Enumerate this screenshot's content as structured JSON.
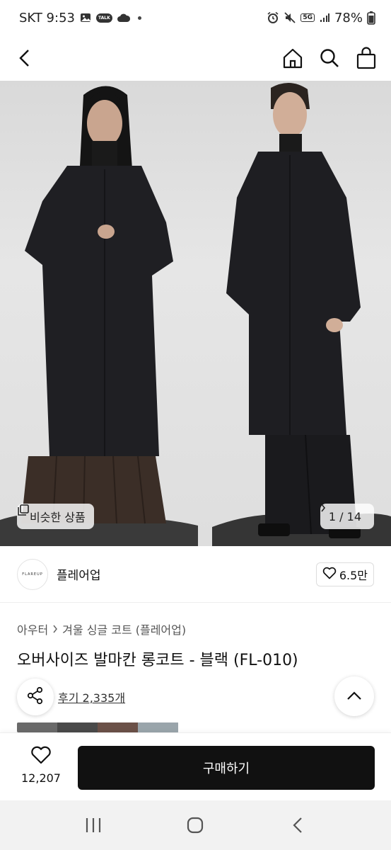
{
  "status_bar": {
    "carrier_time": "SKT 9:53",
    "talk_badge": "TALK",
    "network": "5G",
    "battery": "78%"
  },
  "hero": {
    "similar_label": "비슷한 상품",
    "page_indicator": "1 / 14"
  },
  "brand": {
    "logo_text": "FLAREUP",
    "name": "플레어업",
    "likes": "6.5만"
  },
  "product": {
    "breadcrumb": [
      "아우터",
      "겨울 싱글 코트 (플레어업)"
    ],
    "title": "오버사이즈 발마칸 롱코트 - 블랙 (FL-010)",
    "review_link": "후기 2,335개"
  },
  "action_bar": {
    "wish_count": "12,207",
    "buy_label": "구매하기"
  },
  "colors": {
    "accent": "#111111",
    "background": "#ffffff",
    "coat": "#1d1d20"
  }
}
